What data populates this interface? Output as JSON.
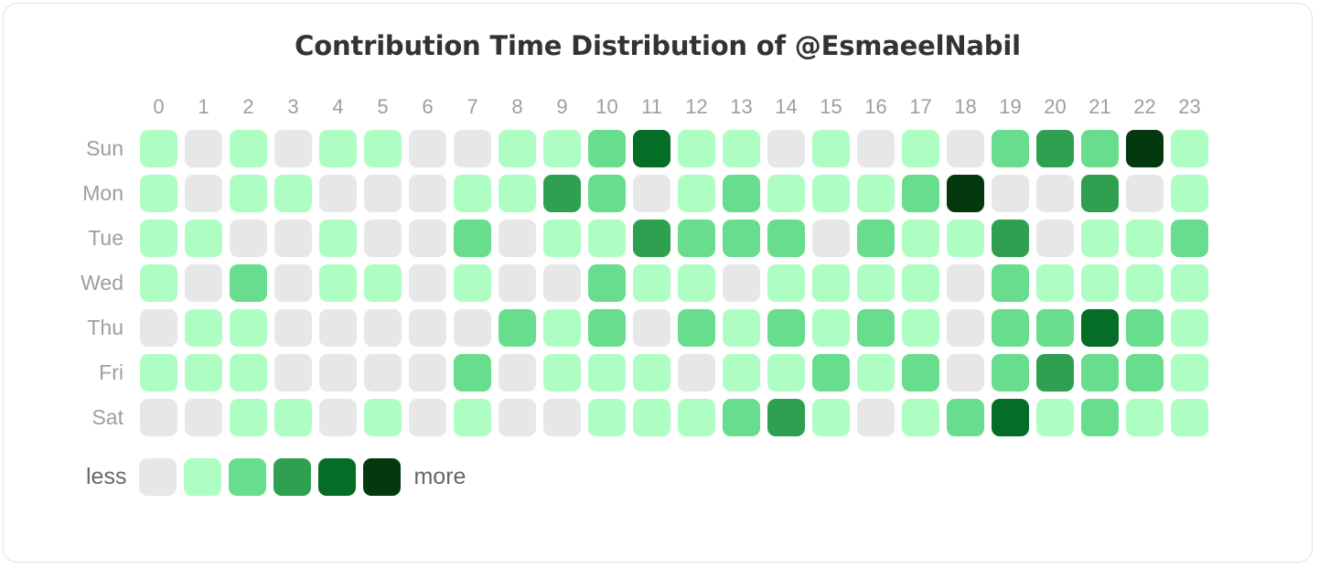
{
  "title": "Contribution Time Distribution of @EsmaeelNabil",
  "hours": [
    "0",
    "1",
    "2",
    "3",
    "4",
    "5",
    "6",
    "7",
    "8",
    "9",
    "10",
    "11",
    "12",
    "13",
    "14",
    "15",
    "16",
    "17",
    "18",
    "19",
    "20",
    "21",
    "22",
    "23"
  ],
  "days": [
    "Sun",
    "Mon",
    "Tue",
    "Wed",
    "Thu",
    "Fri",
    "Sat"
  ],
  "legend": {
    "less_label": "less",
    "more_label": "more",
    "levels": [
      0,
      1,
      2,
      3,
      4,
      5
    ]
  },
  "colors": {
    "level0": "#e7e7e7",
    "level1": "#aefec4",
    "level2": "#68dd8d",
    "level3": "#2ea04f",
    "level4": "#046d26",
    "level5": "#04390f",
    "title_color": "#333333",
    "axis_label_color": "#9e9e9e",
    "legend_text_color": "#666666",
    "card_border": "#e4e2e2",
    "background": "#ffffff"
  },
  "chart_data": {
    "type": "heatmap",
    "title": "Contribution Time Distribution of @EsmaeelNabil",
    "xlabel": "",
    "ylabel": "",
    "x": [
      "0",
      "1",
      "2",
      "3",
      "4",
      "5",
      "6",
      "7",
      "8",
      "9",
      "10",
      "11",
      "12",
      "13",
      "14",
      "15",
      "16",
      "17",
      "18",
      "19",
      "20",
      "21",
      "22",
      "23"
    ],
    "y": [
      "Sun",
      "Mon",
      "Tue",
      "Wed",
      "Thu",
      "Fri",
      "Sat"
    ],
    "zlim": [
      0,
      5
    ],
    "legend_position": "bottom-left",
    "grid": false,
    "series": [
      {
        "name": "Sun",
        "values": [
          1,
          0,
          1,
          0,
          1,
          1,
          0,
          0,
          1,
          1,
          2,
          4,
          1,
          1,
          0,
          1,
          0,
          1,
          0,
          2,
          3,
          2,
          5,
          1
        ]
      },
      {
        "name": "Mon",
        "values": [
          1,
          0,
          1,
          1,
          0,
          0,
          0,
          1,
          1,
          3,
          2,
          0,
          1,
          2,
          1,
          1,
          1,
          2,
          5,
          0,
          0,
          3,
          0,
          1
        ]
      },
      {
        "name": "Tue",
        "values": [
          1,
          1,
          0,
          0,
          1,
          0,
          0,
          2,
          0,
          1,
          1,
          3,
          2,
          2,
          2,
          0,
          2,
          1,
          1,
          3,
          0,
          1,
          1,
          2
        ]
      },
      {
        "name": "Wed",
        "values": [
          1,
          0,
          2,
          0,
          1,
          1,
          0,
          1,
          0,
          0,
          2,
          1,
          1,
          0,
          1,
          1,
          1,
          1,
          0,
          2,
          1,
          1,
          1,
          1
        ]
      },
      {
        "name": "Thu",
        "values": [
          0,
          1,
          1,
          0,
          0,
          0,
          0,
          0,
          2,
          1,
          2,
          0,
          2,
          1,
          2,
          1,
          2,
          1,
          0,
          2,
          2,
          4,
          2,
          1
        ]
      },
      {
        "name": "Fri",
        "values": [
          1,
          1,
          1,
          0,
          0,
          0,
          0,
          2,
          0,
          1,
          1,
          1,
          0,
          1,
          1,
          2,
          1,
          2,
          0,
          2,
          3,
          2,
          2,
          1
        ]
      },
      {
        "name": "Sat",
        "values": [
          0,
          0,
          1,
          1,
          0,
          1,
          0,
          1,
          0,
          0,
          1,
          1,
          1,
          2,
          3,
          1,
          0,
          1,
          2,
          4,
          1,
          2,
          1,
          1
        ]
      }
    ]
  }
}
